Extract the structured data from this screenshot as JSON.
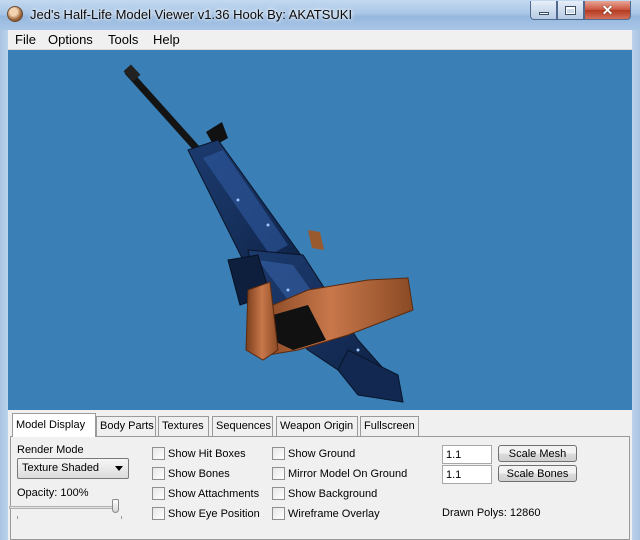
{
  "window": {
    "title": "Jed's Half-Life Model Viewer v1.36 Hook By: AKATSUKI",
    "icon": "app-head-icon"
  },
  "menu": [
    "File",
    "Options",
    "Tools",
    "Help"
  ],
  "colors": {
    "viewport_background": "#3a7fb5",
    "titlebar": "#a9c6e6",
    "close_button": "#c9533c"
  },
  "tabs": [
    "Model Display",
    "Body Parts",
    "Textures",
    "Sequences",
    "Weapon Origin",
    "Fullscreen"
  ],
  "active_tab": "Model Display",
  "model_display": {
    "render_mode_label": "Render Mode",
    "render_mode_value": "Texture Shaded",
    "opacity_label": "Opacity: 100%",
    "opacity_value": 1.0,
    "checkboxes_col1": [
      {
        "label": "Show Hit Boxes",
        "checked": false
      },
      {
        "label": "Show Bones",
        "checked": false
      },
      {
        "label": "Show Attachments",
        "checked": false
      },
      {
        "label": "Show Eye Position",
        "checked": false
      }
    ],
    "checkboxes_col2": [
      {
        "label": "Show Ground",
        "checked": false
      },
      {
        "label": "Mirror Model On Ground",
        "checked": false
      },
      {
        "label": "Show Background",
        "checked": false
      },
      {
        "label": "Wireframe Overlay",
        "checked": false
      }
    ],
    "scale_mesh_value": "1.1",
    "scale_mesh_label": "Scale Mesh",
    "scale_bones_value": "1.1",
    "scale_bones_label": "Scale Bones",
    "drawn_polys": "Drawn Polys: 12860"
  }
}
